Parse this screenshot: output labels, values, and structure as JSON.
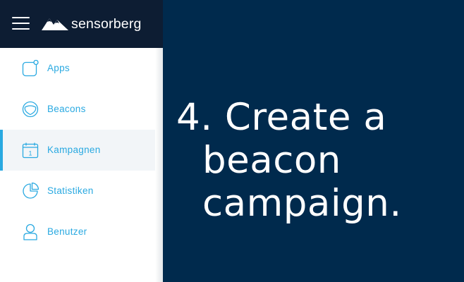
{
  "app": {
    "brand": "sensorberg",
    "colors": {
      "topbar": "#0d1d33",
      "accent": "#29a9e1",
      "hero_bg": "#002a4d",
      "active_row": "#f2f5f8"
    }
  },
  "header": {
    "menu_icon": "hamburger-menu-icon",
    "logo_icon": "sensorberg-mountain-logo"
  },
  "sidebar": {
    "active_item": "Kampagnen",
    "items": [
      {
        "label": "Apps",
        "icon": "app-icon"
      },
      {
        "label": "Beacons",
        "icon": "beacon-icon"
      },
      {
        "label": "Kampagnen",
        "icon": "calendar-icon",
        "icon_text": "1"
      },
      {
        "label": "Statistiken",
        "icon": "pie-chart-icon"
      },
      {
        "label": "Benutzer",
        "icon": "user-icon"
      }
    ]
  },
  "hero": {
    "lines": [
      "4. Create a",
      "beacon",
      "campaign."
    ]
  }
}
